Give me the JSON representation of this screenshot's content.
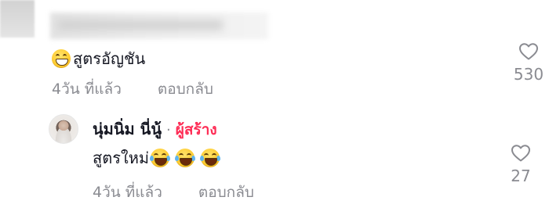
{
  "comments": [
    {
      "text": "สูตรอัญชัน",
      "emojis": [
        "grin-emoji"
      ],
      "time": "4วัน ที่แล้ว",
      "reply_label": "ตอบกลับ",
      "likes": "530"
    },
    {
      "author": "นุ่มนิ่ม นี่นู้",
      "separator": "·",
      "badge": "ผู้สร้าง",
      "text": "สูตรใหม่",
      "emojis": [
        "laugh-tears-emoji",
        "laugh-tears-emoji",
        "laugh-tears-emoji"
      ],
      "time": "4วัน ที่แล้ว",
      "reply_label": "ตอบกลับ",
      "likes": "27"
    }
  ],
  "icons": {
    "like": "heart-outline-icon"
  },
  "colors": {
    "text": "#161823",
    "muted": "#8a8b91",
    "creator_badge": "#fe2c55"
  }
}
